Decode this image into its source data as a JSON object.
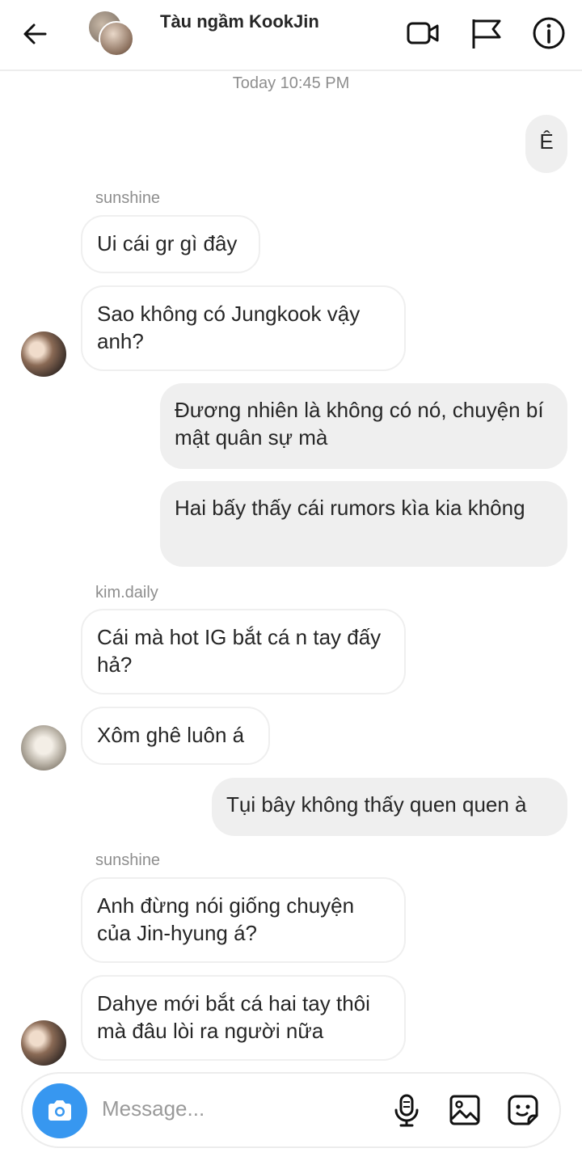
{
  "header": {
    "title": "Tàu ngầm KookJin",
    "icons": [
      "back-arrow-icon",
      "video-call-icon",
      "flag-icon",
      "info-icon"
    ]
  },
  "timestamp": "Today 10:45 PM",
  "messages": [
    {
      "dir": "out",
      "text": "Ê"
    },
    {
      "dir": "in",
      "sender": "sunshine",
      "text": "Ui cái gr gì đây"
    },
    {
      "dir": "in",
      "text": "Sao không có Jungkook vậy anh?"
    },
    {
      "dir": "out",
      "text": "Đương nhiên là không có nó, chuyện bí mật quân sự mà"
    },
    {
      "dir": "out",
      "text": "Hai bấy thấy cái rumors kìa kia không"
    },
    {
      "dir": "in",
      "sender": "kim.daily",
      "text": "Cái mà hot IG bắt cá n tay đấy hả?"
    },
    {
      "dir": "in",
      "text": "Xôm ghê luôn á"
    },
    {
      "dir": "out",
      "text": "Tụi bây không thấy quen quen à"
    },
    {
      "dir": "in",
      "sender": "sunshine",
      "text": "Anh đừng nói giống chuyện của Jin-hyung á?"
    },
    {
      "dir": "in",
      "text": "Dahye mới bắt cá hai tay thôi mà đâu lòi ra người nữa"
    }
  ],
  "composer": {
    "placeholder": "Message...",
    "icons": [
      "camera-icon",
      "microphone-icon",
      "gallery-icon",
      "sticker-icon"
    ]
  },
  "colors": {
    "accent": "#3797f0",
    "outgoing_bubble": "#efefef",
    "incoming_border": "#efefef",
    "meta_text": "#8e8e8e"
  }
}
